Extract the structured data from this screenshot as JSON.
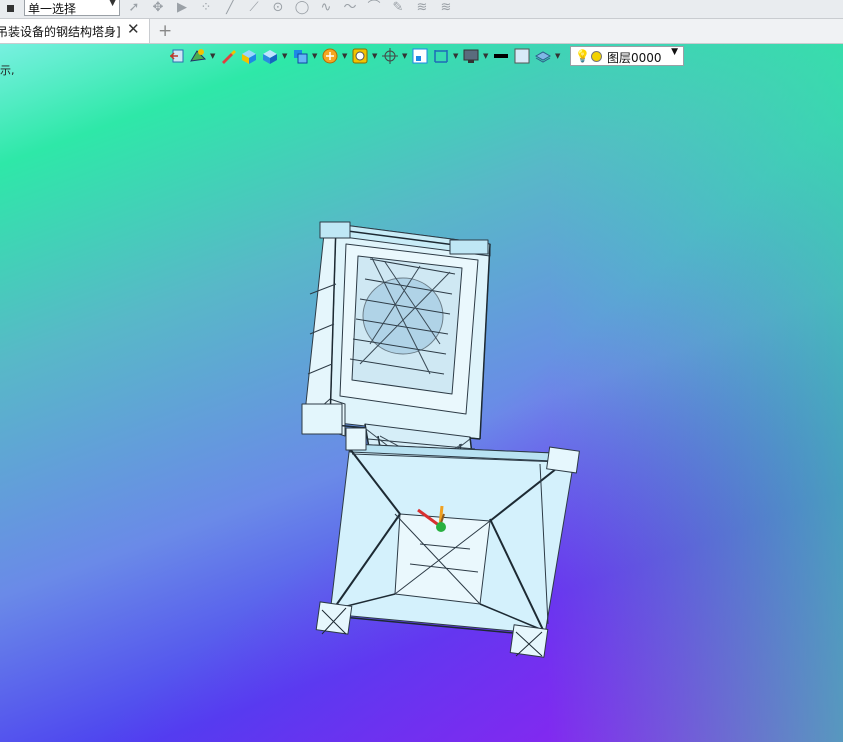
{
  "topbar": {
    "select_mode": "单一选择",
    "snap_icons": [
      "cursor-arrow-icon",
      "pick-filter-icon",
      "play-icon",
      "point-snap-icon",
      "line-icon",
      "line-end-icon",
      "circle-center-icon",
      "circle-icon",
      "curve-icon",
      "spline-icon",
      "arc-icon",
      "pen-icon",
      "layer-stack-icon",
      "layer-stack-2-icon"
    ]
  },
  "tabs": {
    "active_title": "吊装设备的钢结构塔身]",
    "close_glyph": "✕",
    "add_glyph": "+"
  },
  "viewport": {
    "truncated_text": "示,"
  },
  "viewbar": {
    "layer_name": "图层0000"
  }
}
